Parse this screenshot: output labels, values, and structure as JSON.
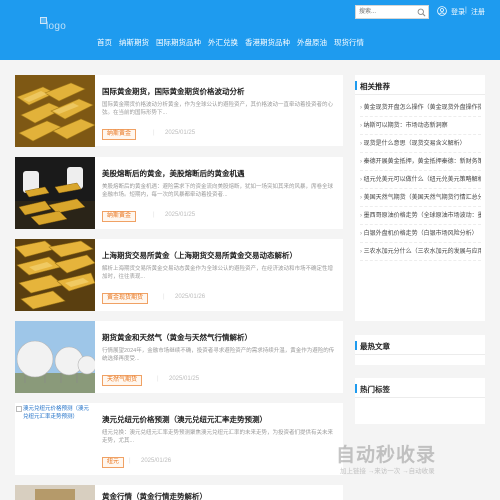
{
  "header": {
    "logo_alt": "logo",
    "search_placeholder": "搜索...",
    "login": "登录",
    "separator": "|",
    "register": "注册"
  },
  "nav": [
    "首页",
    "纳斯期货",
    "国际期货品种",
    "外汇兑换",
    "香港期货品种",
    "外盘原油",
    "现货行情"
  ],
  "articles": [
    {
      "title": "国际黄金期货，国际黄金期货价格波动分析",
      "excerpt": "国际黄金期货价格波动分析黄金，作为全球公认的避险资产，其价格波动一直牵动着投资者的心弦。在当前的国际形势下...",
      "tag": "纳斯黄金",
      "date": "2025/01/25"
    },
    {
      "title": "美股熔断后的黄金，美股熔断后的黄金机遇",
      "excerpt": "美股熔断后的黄金机遇：避险需求下的资金流向美股熔断，犹如一场突如其来的风暴，席卷全球金融市场。短期内，每一次的风暴都牵动着投资者...",
      "tag": "纳斯黄金",
      "date": "2025/01/25"
    },
    {
      "title": "上海期货交易所黄金（上海期货交易所黄金交易动态解析）",
      "excerpt": "解析上海期货交易所黄金交易动态黄金作为全球公认的避险资产，在经济波动和市场不确定性增加时，往往表现...",
      "tag": "黄金现货期货",
      "date": "2025/01/26"
    },
    {
      "title": "期货黄金和天然气（黄金与天然气行情解析）",
      "excerpt": "行情展望2024年，金融市场继续不确，投资者寻求避险资产的需求持续升温，黄金作为避险的传统选择再度受...",
      "tag": "天然气期货",
      "date": "2025/01/25"
    },
    {
      "title": "澳元兑纽元价格预测（澳元兑纽元汇率走势预测）",
      "excerpt": "纽元兑换：澳元兑纽元汇率走势预测聚焦澳元兑纽元汇率的未来走势，为投资者们提供有关未来走势，尤其...",
      "tag": "纽元",
      "date": "2025/01/26"
    },
    {
      "title": "黄金行情（黄金行情走势解析）",
      "excerpt": "",
      "tag": "",
      "date": ""
    }
  ],
  "article5_img_alt": "澳元兑纽元价格预测（澳元兑纽元汇率走势预测）",
  "sidebar": {
    "related_title": "相关推荐",
    "related": [
      "黄金现货开盘怎么操作（黄金现货外盘操作指南）",
      "纳斯可以期货：市场动态新洞察",
      "现货是什么意思（现货交易含义解析）",
      "秦德开展黄金抵押，黄金抵押秦德：新财务策略...",
      "纽元兑美元可以做什么（纽元兑美元策略解析）",
      "美国天然气期货（美国天然气期货行情汇总分析）",
      "墨西哥原油价格走势（全球原油市场波动：墨西哥...",
      "白银外盘机价格走势（白银市场风险分析）",
      "三农水加元分什么（三农水加元的发展与应用...）"
    ],
    "latest_title": "最热文章",
    "tags_title": "热门标签"
  },
  "watermark": {
    "title": "自动秒收录",
    "subtitle": "加上链接 →来访一次 →自动收录"
  },
  "colors": {
    "brand": "#1e9bef",
    "tag": "#e8731b"
  }
}
